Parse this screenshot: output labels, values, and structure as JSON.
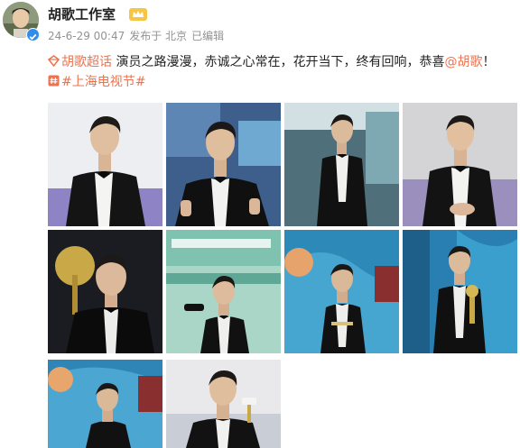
{
  "post": {
    "author": {
      "name": "胡歌工作室",
      "avatar": "avatar-photo",
      "verified": true,
      "badge": "vip-crown-icon"
    },
    "meta": {
      "timestamp": "24-6-29 00:47",
      "source": "发布于 北京",
      "edited": "已编辑"
    },
    "content": {
      "supertopic": "胡歌超话",
      "text": " 演员之路漫漫，赤诚之心常在，花开当下，终有回响，恭喜",
      "mention": "@胡歌",
      "exclamation": "！",
      "hashtag": "#上海电视节#"
    },
    "photos": [
      "photo-1-black-tuxedo-purple-backdrop",
      "photo-2-thumbs-up-blue-backdrop",
      "photo-3-full-length-stage",
      "photo-4-hands-clasped",
      "photo-5-holding-trophy-closeup",
      "photo-6-green-magnolia-backdrop",
      "photo-7-stage-with-trophy",
      "photo-8-receiving-award",
      "photo-9-blue-stage",
      "photo-10-smiling-with-trophy"
    ],
    "colors": {
      "link": "#eb7350",
      "meta": "#939393",
      "verified": "#2f8ce8",
      "text": "#222222"
    }
  }
}
